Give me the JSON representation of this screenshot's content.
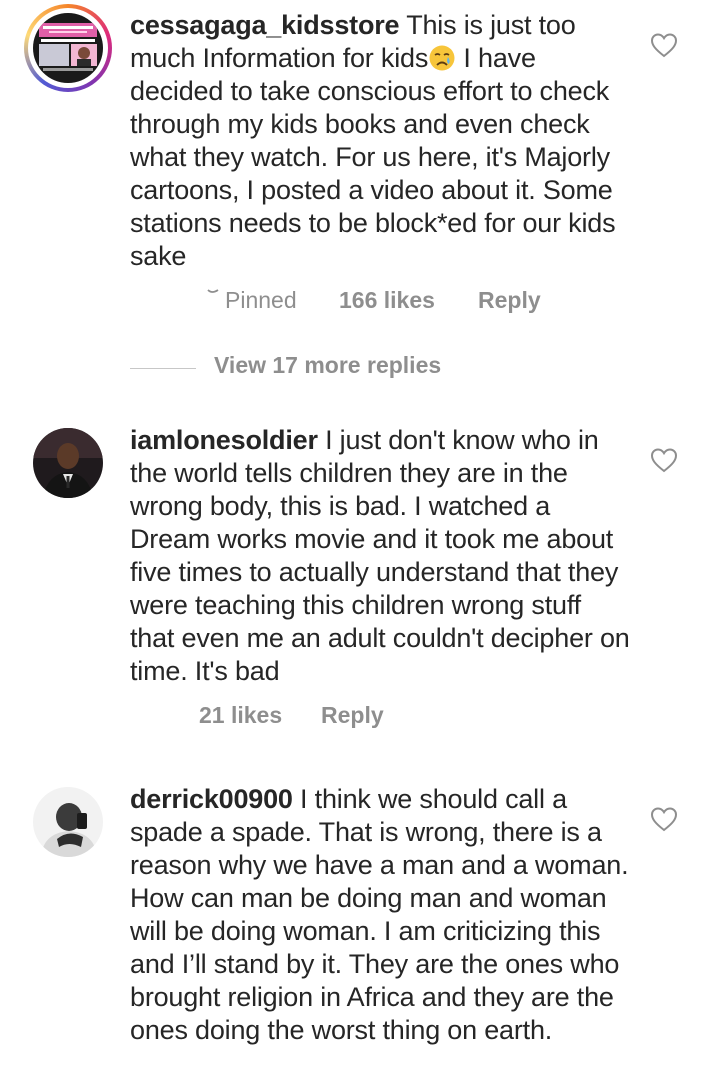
{
  "comments": [
    {
      "username": "cessagaga_kidsstore",
      "text_before_emoji": " This is just too much Information for kids",
      "emoji": "crying-face-emoji",
      "text_after_emoji": " I have decided to take conscious effort to check through my kids books and even check what they watch. For us here, it's Majorly cartoons, I posted a video about it. Some stations needs to be block*ed for our kids sake",
      "pinned_label": "Pinned",
      "likes": "166 likes",
      "reply_label": "Reply",
      "view_replies": "View 17 more replies"
    },
    {
      "username": "iamlonesoldier",
      "text": " I just don't know who in the world tells children they are in the wrong body, this is bad. I watched a Dream works movie and it took me about five times to actually understand that they were teaching this children wrong stuff that even me an adult couldn't decipher on time. It's bad",
      "likes": "21 likes",
      "reply_label": "Reply"
    },
    {
      "username": "derrick00900",
      "text": " I think we should call a spade a spade. That is wrong, there is a reason why we have a man and a woman. How can man be doing man and woman will be doing woman. I am criticizing this and I’ll stand by it. They are the ones who brought religion in Africa and they are the ones doing the worst thing on earth."
    }
  ],
  "colors": {
    "text": "#262626",
    "meta": "#8e8e8e",
    "divider": "#c7c7c7"
  }
}
